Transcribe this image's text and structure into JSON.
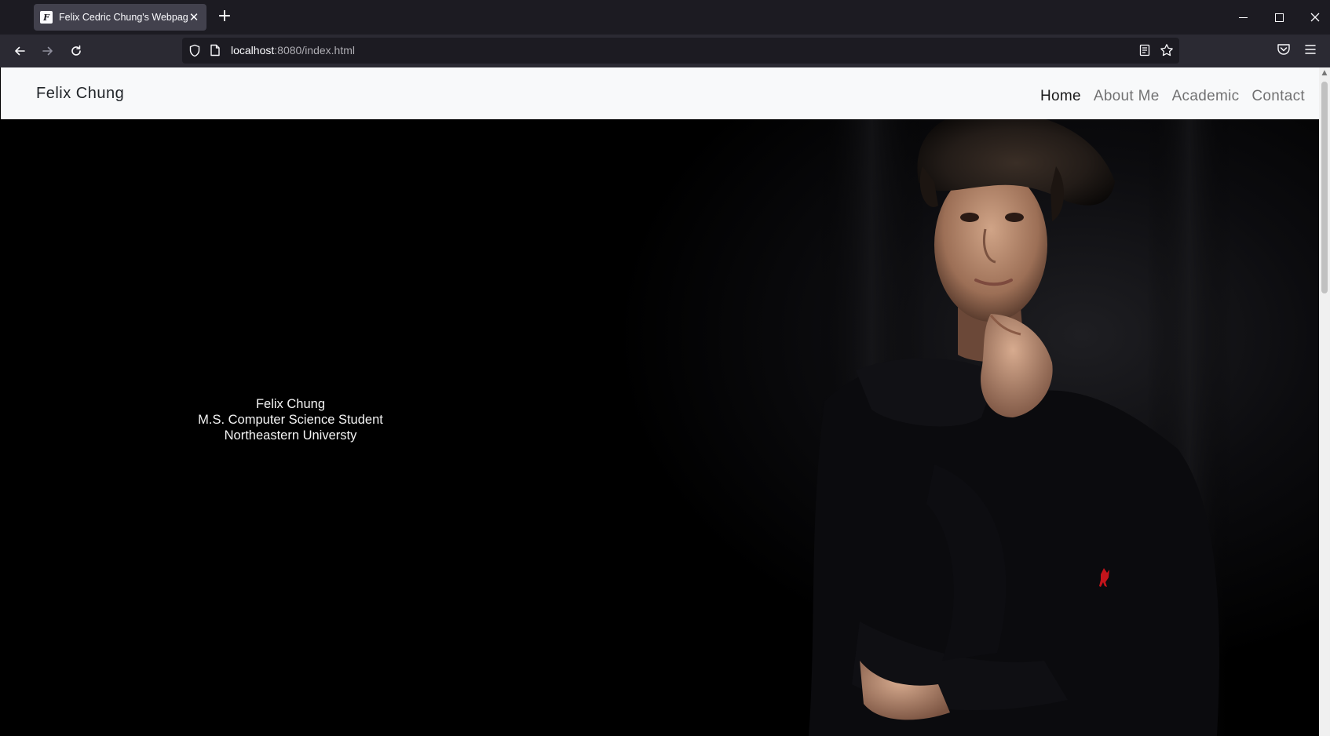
{
  "browser": {
    "tab": {
      "title": "Felix Cedric Chung's Webpage",
      "favicon": "F"
    },
    "url": {
      "host": "localhost",
      "rest": ":8080/index.html"
    }
  },
  "site": {
    "brand": "Felix Chung",
    "nav": [
      {
        "label": "Home",
        "active": true
      },
      {
        "label": "About Me",
        "active": false
      },
      {
        "label": "Academic",
        "active": false
      },
      {
        "label": "Contact",
        "active": false
      }
    ]
  },
  "hero": {
    "name": "Felix Chung",
    "role": "M.S. Computer Science Student",
    "school": "Northeastern Universty"
  },
  "colors": {
    "chrome_dark": "#1c1b22",
    "chrome_toolbar": "#2b2a33",
    "nav_bg": "#f8f9fa",
    "hero_bg": "#000000",
    "logo_red": "#c4141b"
  }
}
